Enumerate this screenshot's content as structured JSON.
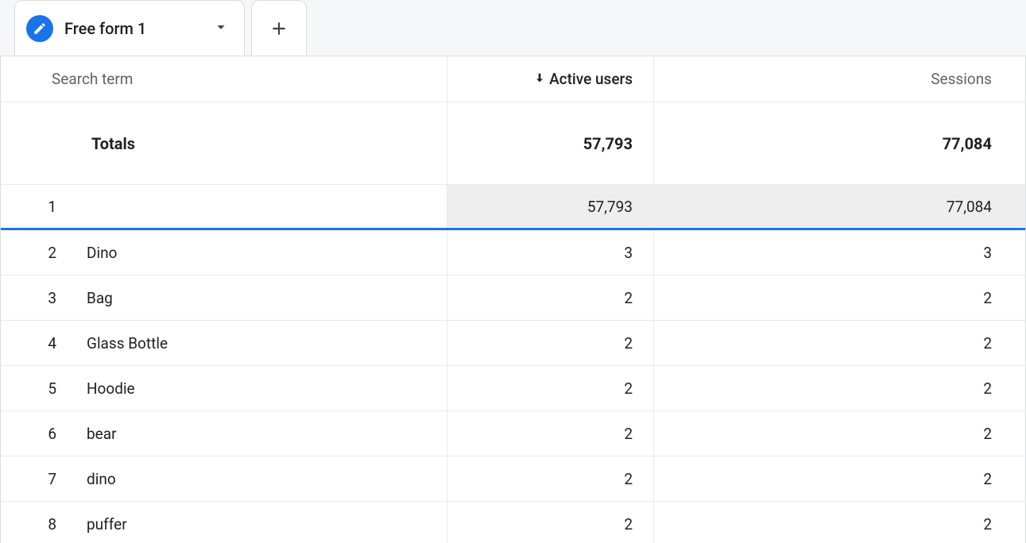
{
  "tab": {
    "label": "Free form 1"
  },
  "columns": {
    "dimension": "Search term",
    "metric1": "Active users",
    "metric2": "Sessions"
  },
  "totals": {
    "label": "Totals",
    "active_users": "57,793",
    "sessions": "77,084"
  },
  "rows": [
    {
      "idx": "1",
      "term": "",
      "active_users": "57,793",
      "sessions": "77,084",
      "highlight": true
    },
    {
      "idx": "2",
      "term": "Dino",
      "active_users": "3",
      "sessions": "3"
    },
    {
      "idx": "3",
      "term": "Bag",
      "active_users": "2",
      "sessions": "2"
    },
    {
      "idx": "4",
      "term": "Glass Bottle",
      "active_users": "2",
      "sessions": "2"
    },
    {
      "idx": "5",
      "term": "Hoodie",
      "active_users": "2",
      "sessions": "2"
    },
    {
      "idx": "6",
      "term": "bear",
      "active_users": "2",
      "sessions": "2"
    },
    {
      "idx": "7",
      "term": "dino",
      "active_users": "2",
      "sessions": "2"
    },
    {
      "idx": "8",
      "term": "puffer",
      "active_users": "2",
      "sessions": "2"
    }
  ]
}
